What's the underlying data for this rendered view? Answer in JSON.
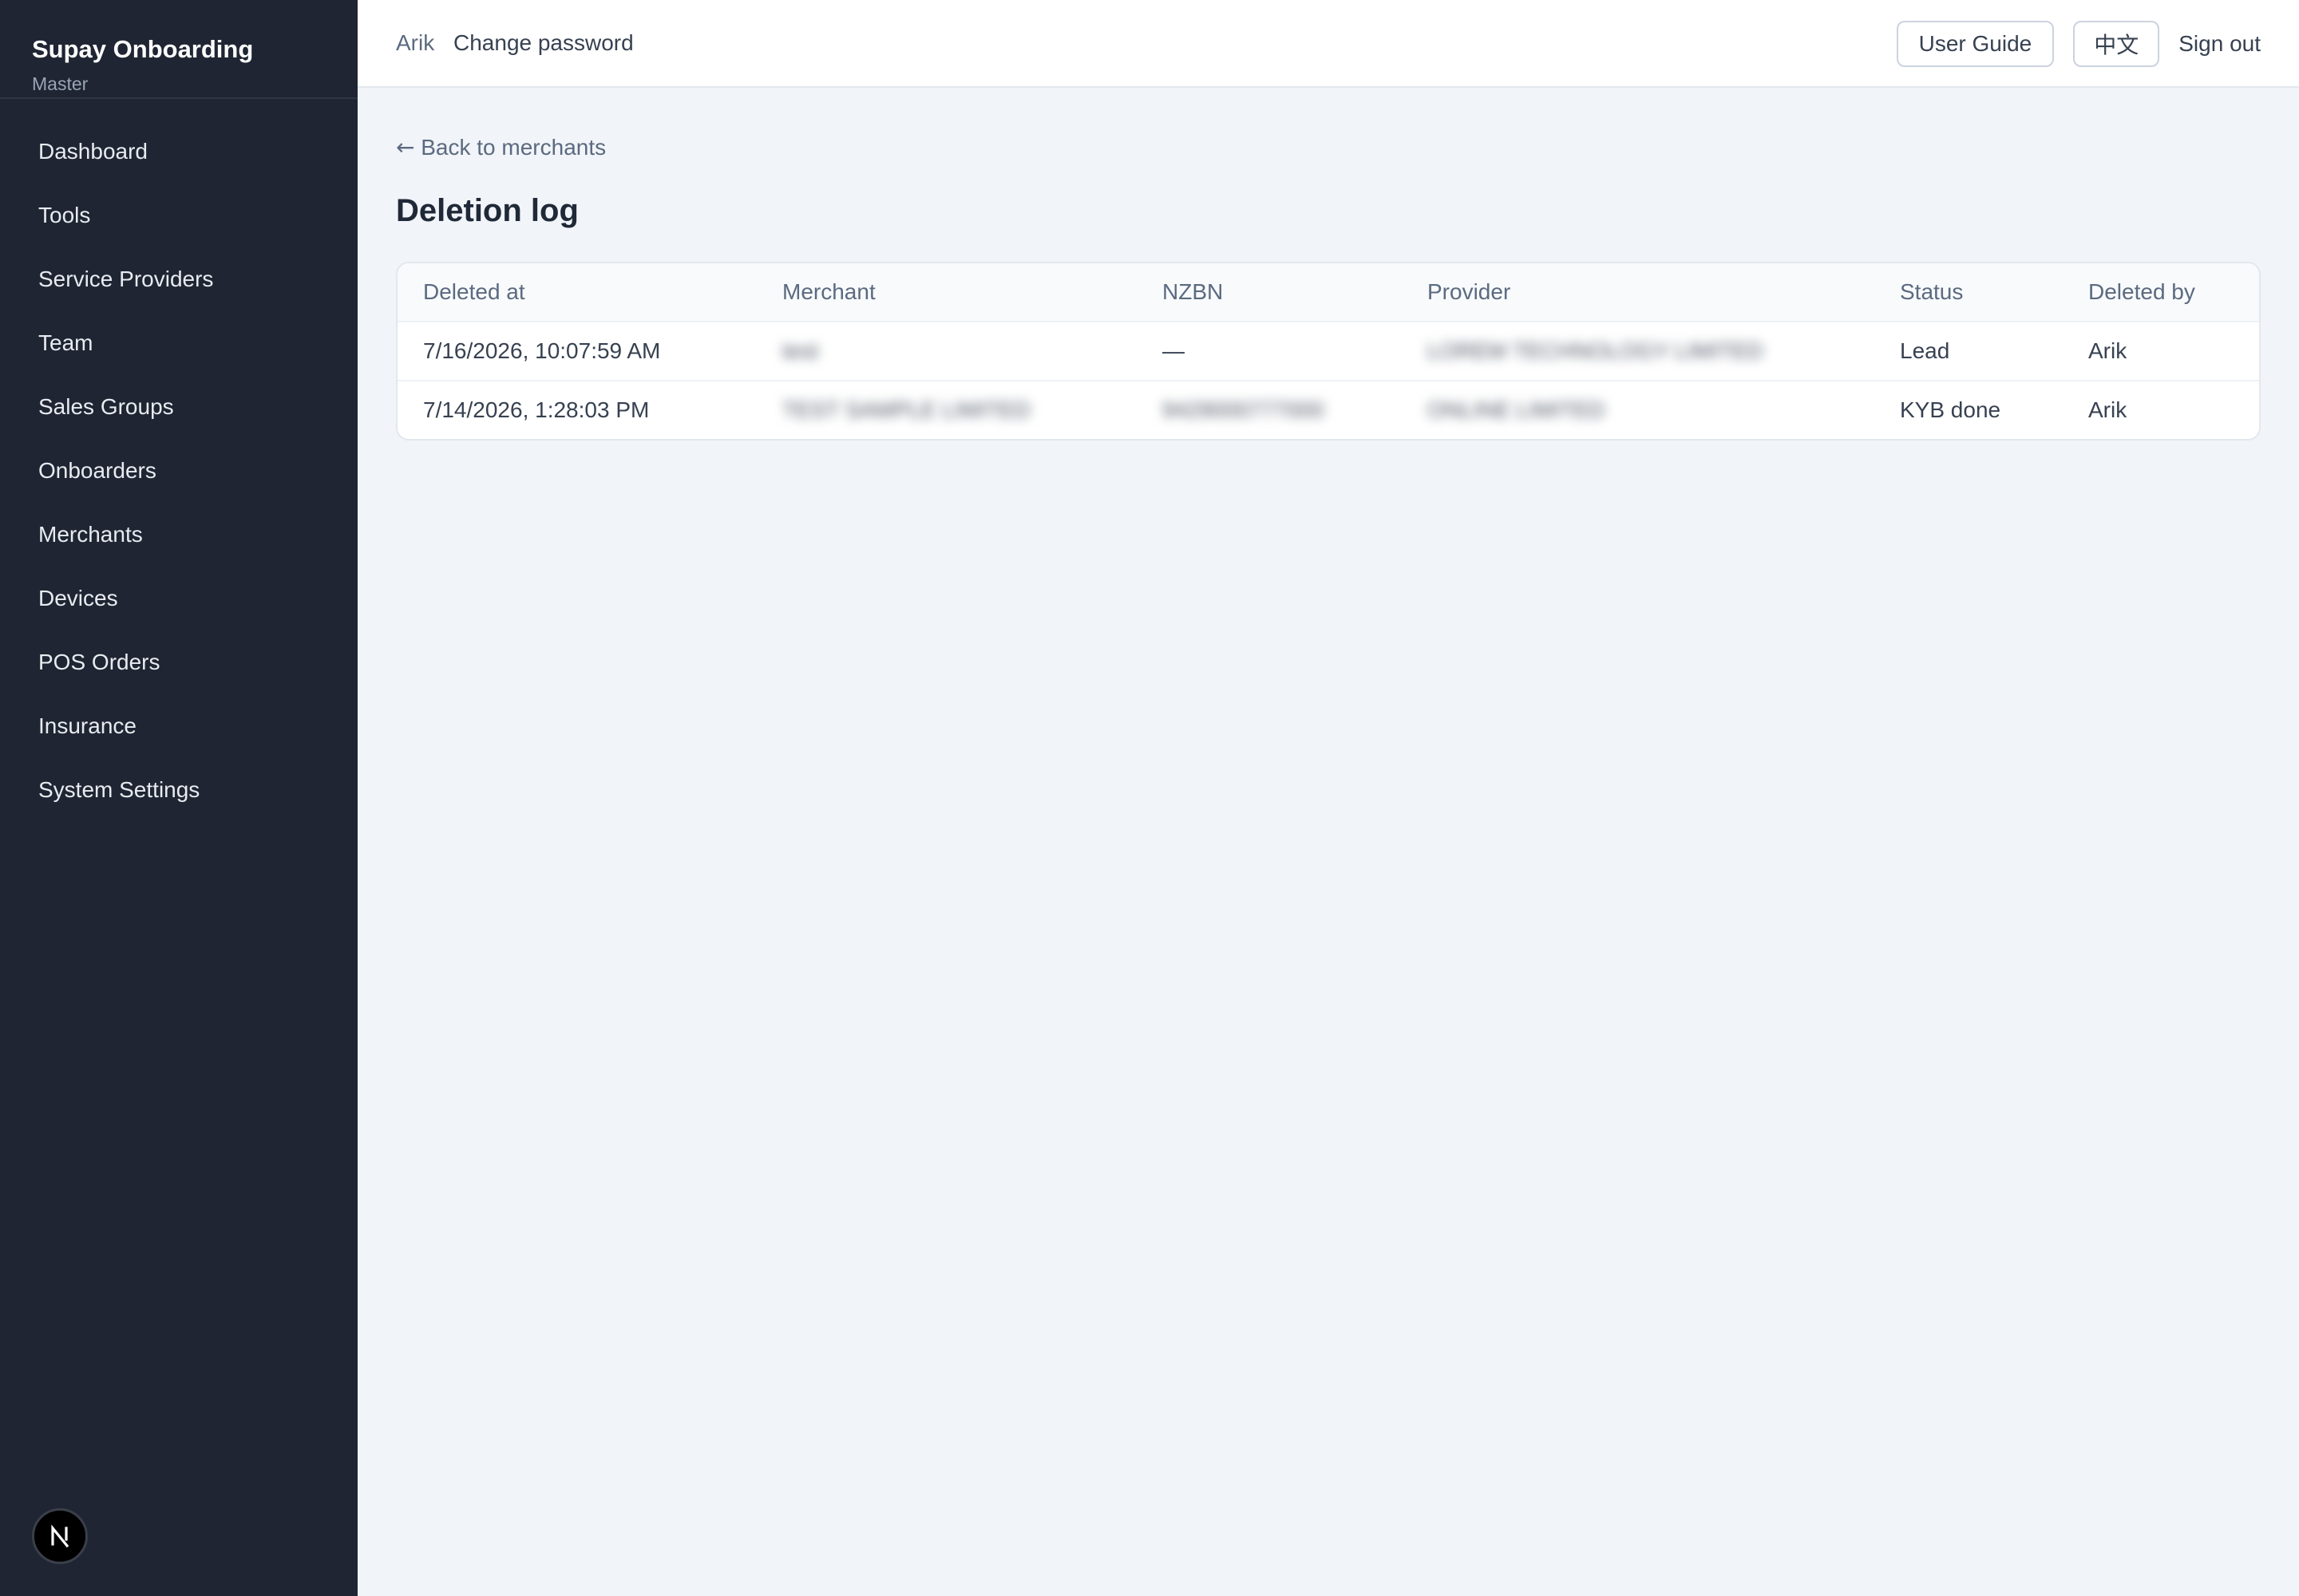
{
  "sidebar": {
    "brand_title": "Supay Onboarding",
    "brand_subtitle": "Master",
    "items": [
      {
        "label": "Dashboard"
      },
      {
        "label": "Tools"
      },
      {
        "label": "Service Providers"
      },
      {
        "label": "Team"
      },
      {
        "label": "Sales Groups"
      },
      {
        "label": "Onboarders"
      },
      {
        "label": "Merchants"
      },
      {
        "label": "Devices"
      },
      {
        "label": "POS Orders"
      },
      {
        "label": "Insurance"
      },
      {
        "label": "System Settings"
      }
    ],
    "badge_letter": "N"
  },
  "header": {
    "user_name": "Arik",
    "change_password": "Change password",
    "user_guide": "User Guide",
    "language": "中文",
    "sign_out": "Sign out"
  },
  "main": {
    "back_arrow": "←",
    "back_label": "Back to merchants",
    "title": "Deletion log",
    "columns": [
      "Deleted at",
      "Merchant",
      "NZBN",
      "Provider",
      "Status",
      "Deleted by"
    ],
    "rows": [
      {
        "deleted_at": "7/16/2026, 10:07:59 AM",
        "merchant": "test",
        "nzbn": "—",
        "provider": "LOREM TECHNOLOGY LIMITED",
        "status": "Lead",
        "deleted_by": "Arik"
      },
      {
        "deleted_at": "7/14/2026, 1:28:03 PM",
        "merchant": "TEST SAMPLE LIMITED",
        "nzbn": "9429000777000",
        "provider": "ONLINE LIMITED",
        "status": "KYB done",
        "deleted_by": "Arik"
      }
    ]
  },
  "colors": {
    "sidebar_bg": "#1f2532",
    "page_bg": "#f1f4f8",
    "accent_text": "#5b6a80"
  }
}
